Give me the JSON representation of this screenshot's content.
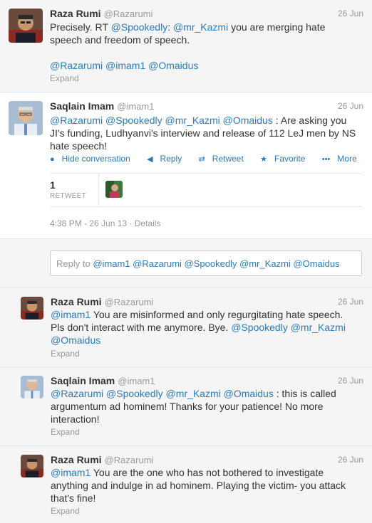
{
  "tweets": [
    {
      "name": "Raza Rumi",
      "handle": "@Razarumi",
      "date": "26 Jun",
      "text_a": "Precisely. RT ",
      "mention_a": "@Spookedly",
      "text_b": ": ",
      "mention_b": "@mr_Kazmi",
      "text_c": " you are merging hate speech and freedom of speech.",
      "m1": "@Razarumi",
      "m2": "@imam1",
      "m3": "@Omaidus",
      "expand": "Expand"
    },
    {
      "name": "Saqlain Imam",
      "handle": "@imam1",
      "date": "26 Jun",
      "m1": "@Razarumi",
      "m2": "@Spookedly",
      "m3": "@mr_Kazmi",
      "m4": "@Omaidus",
      "text": " : Are asking you JI's funding, Ludhyanvi's interview and release of 112 LeJ men by NS hate speech!",
      "actions": {
        "hide": "Hide conversation",
        "reply": "Reply",
        "retweet": "Retweet",
        "favorite": "Favorite",
        "more": "More"
      },
      "retweet_count": "1",
      "retweet_label": "RETWEET",
      "timestamp": "4:38 PM - 26 Jun 13",
      "sep": " · ",
      "details": "Details"
    },
    {
      "name": "Raza Rumi",
      "handle": "@Razarumi",
      "date": "26 Jun",
      "m1": "@imam1",
      "text": " You are misinformed and only regurgitating hate speech. Pls don't interact with me anymore. Bye. ",
      "m2": "@Spookedly",
      "m3": "@mr_Kazmi",
      "m4": "@Omaidus",
      "expand": "Expand"
    },
    {
      "name": "Saqlain Imam",
      "handle": "@imam1",
      "date": "26 Jun",
      "m1": "@Razarumi",
      "m2": "@Spookedly",
      "m3": "@mr_Kazmi",
      "m4": "@Omaidus",
      "text": " : this is called argumentum ad hominem! Thanks for your patience! No more interaction!",
      "expand": "Expand"
    },
    {
      "name": "Raza Rumi",
      "handle": "@Razarumi",
      "date": "26 Jun",
      "m1": "@imam1",
      "text": " You are the one who has not bothered to investigate anything and indulge in ad hominem. Playing the victim- you attack that's fine!",
      "expand": "Expand"
    }
  ],
  "reply_box": {
    "prefix": "Reply to ",
    "mentions": "@imam1 @Razarumi @Spookedly @mr_Kazmi @Omaidus"
  },
  "colors": {
    "link": "#2b7bb9",
    "muted": "#999999",
    "bg_grey": "#f5f5f5"
  }
}
